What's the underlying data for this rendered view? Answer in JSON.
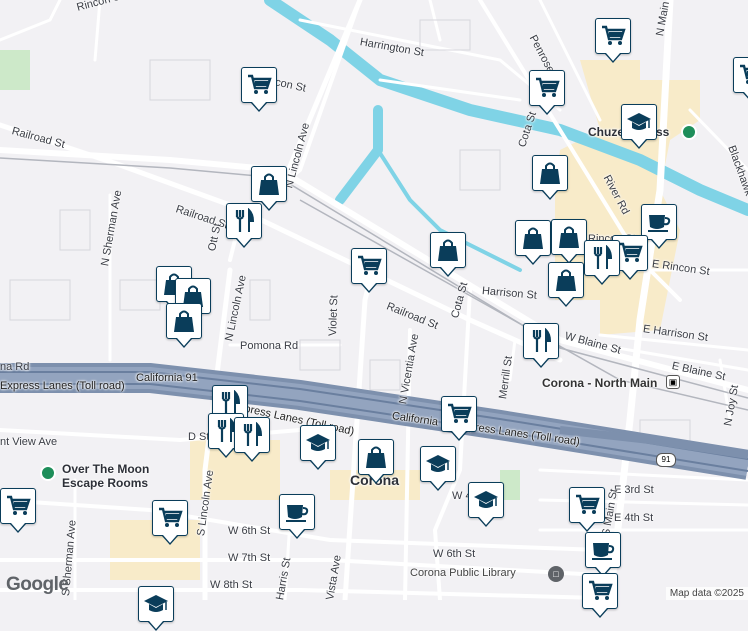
{
  "map": {
    "attribution": "Map data ©2025",
    "google_logo": "Google",
    "colors": {
      "background": "#f2f1f4",
      "water": "#7fd3e6",
      "highway": "#7d90ad",
      "road": "#ffffff",
      "block": "#e6e4ea",
      "commercial": "#f8ebc9",
      "pin_fill": "#0a3d5a",
      "park": "#1e8e5a"
    },
    "street_labels": [
      "Rincon St",
      "Harrington St",
      "Penrose Dr",
      "N Main St",
      "W Rincon St",
      "N Lincoln Ave",
      "Railroad St",
      "Cota St",
      "River Rd",
      "Blackhawk",
      "Railroad St",
      "N Sherman Ave",
      "Ott St",
      "N Lincoln Ave",
      "Rincon St",
      "E Rincon St",
      "Harrison St",
      "Violet St",
      "Railroad St",
      "Cota St",
      "E Harrison St",
      "W Blaine St",
      "E Blaine St",
      "Pomona Rd",
      "N Vicentia Ave",
      "Merrill St",
      "na Rd",
      "California 91",
      "Express Lanes (Toll road)",
      "Express Lanes (Toll road)",
      "California 91 Express Lanes (Toll road)",
      "N Joy St",
      "nt View Ave",
      "D St",
      "S Lincoln Ave",
      "W 4th St",
      "E 3rd St",
      "E 4th St",
      "S Main St",
      "W 6th St",
      "W 6th St",
      "W 7th St",
      "Harris St",
      "Vista Ave",
      "W 8th St",
      "S Sherman Ave"
    ],
    "place_labels": [
      {
        "name": "Chuze Fitness",
        "type": "gym"
      },
      {
        "name": "Corona - North Main",
        "type": "station"
      },
      {
        "name": "Over The Moon Escape Rooms",
        "type": "attraction"
      },
      {
        "name": "Corona",
        "type": "city"
      },
      {
        "name": "Corona Public Library",
        "type": "library"
      }
    ],
    "highway_shield": "91",
    "pins": [
      {
        "icon": "cart-icon"
      },
      {
        "icon": "cart-icon"
      },
      {
        "icon": "cart-icon"
      },
      {
        "icon": "cart-icon"
      },
      {
        "icon": "graduation-cap-icon"
      },
      {
        "icon": "shopping-bag-icon"
      },
      {
        "icon": "shopping-bag-icon"
      },
      {
        "icon": "restaurant-icon"
      },
      {
        "icon": "coffee-icon"
      },
      {
        "icon": "shopping-bag-icon"
      },
      {
        "icon": "shopping-bag-icon"
      },
      {
        "icon": "shopping-bag-icon"
      },
      {
        "icon": "cart-icon"
      },
      {
        "icon": "restaurant-icon"
      },
      {
        "icon": "cart-icon"
      },
      {
        "icon": "shopping-bag-icon"
      },
      {
        "icon": "shopping-bag-icon"
      },
      {
        "icon": "shopping-bag-icon"
      },
      {
        "icon": "shopping-bag-icon"
      },
      {
        "icon": "restaurant-icon"
      },
      {
        "icon": "restaurant-icon"
      },
      {
        "icon": "restaurant-icon"
      },
      {
        "icon": "restaurant-icon"
      },
      {
        "icon": "graduation-cap-icon"
      },
      {
        "icon": "shopping-bag-icon"
      },
      {
        "icon": "cart-icon"
      },
      {
        "icon": "graduation-cap-icon"
      },
      {
        "icon": "graduation-cap-icon"
      },
      {
        "icon": "cart-icon"
      },
      {
        "icon": "coffee-icon"
      },
      {
        "icon": "cart-icon"
      },
      {
        "icon": "coffee-icon"
      },
      {
        "icon": "cart-icon"
      },
      {
        "icon": "graduation-cap-icon"
      },
      {
        "icon": "cart-icon"
      }
    ]
  }
}
